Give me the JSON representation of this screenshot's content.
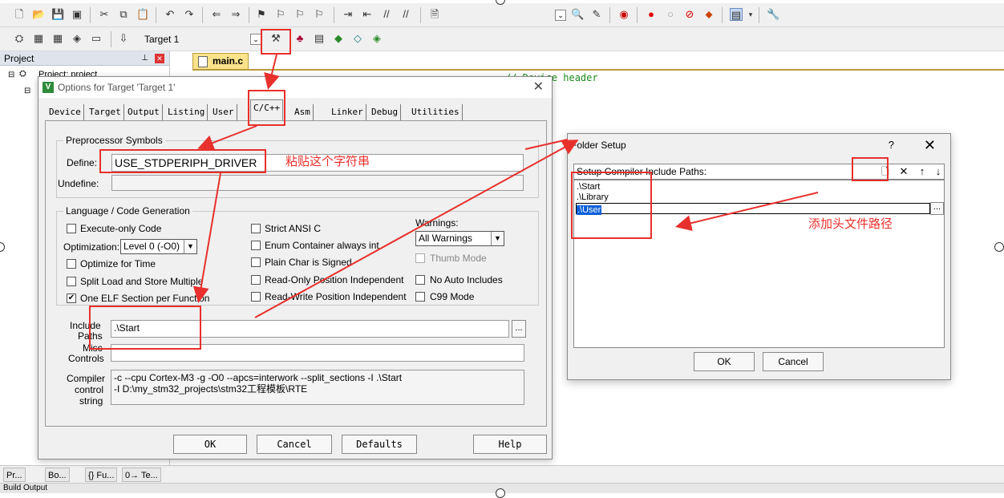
{
  "toolbar2": {
    "target_name": "Target 1"
  },
  "project_panel": {
    "title": "Project",
    "tree_root": "Project: project"
  },
  "bottom_tabs": [
    "Pr...",
    "Bo...",
    "{} Fu...",
    "0→ Te..."
  ],
  "status_text": "Build Output",
  "editor": {
    "tab_label": "main.c",
    "code_comment": "// Device header"
  },
  "options_dialog": {
    "title": "Options for Target 'Target 1'",
    "tabs": [
      "Device",
      "Target",
      "Output",
      "Listing",
      "User",
      "C/C++",
      "Asm",
      "Linker",
      "Debug",
      "Utilities"
    ],
    "preprocessor": {
      "group_title": "Preprocessor Symbols",
      "define_label": "Define:",
      "define_value": "USE_STDPERIPH_DRIVER",
      "undefine_label": "Undefine:"
    },
    "language": {
      "group_title": "Language / Code Generation",
      "execute_only": "Execute-only Code",
      "optimization_label": "Optimization:",
      "optimization_value": "Level 0 (-O0)",
      "optimize_for_time": "Optimize for Time",
      "split_load_store": "Split Load and Store Multiple",
      "one_elf": "One ELF Section per Function",
      "strict_ansi": "Strict ANSI C",
      "enum_container": "Enum Container always int",
      "plain_char": "Plain Char is Signed",
      "ro_position": "Read-Only Position Independent",
      "rw_position": "Read-Write Position Independent",
      "warnings_label": "Warnings:",
      "warnings_value": "All Warnings",
      "thumb_mode": "Thumb Mode",
      "no_auto_includes": "No Auto Includes",
      "c99_mode": "C99 Mode"
    },
    "include_paths_label_1": "Include",
    "include_paths_label_2": "Paths",
    "include_paths_value": ".\\Start",
    "misc_label_1": "Misc",
    "misc_label_2": "Controls",
    "compiler_label_1": "Compiler",
    "compiler_label_2": "control",
    "compiler_label_3": "string",
    "compiler_line1": "-c --cpu Cortex-M3 -g -O0 --apcs=interwork --split_sections -I .\\Start",
    "compiler_line2": "-I D:\\my_stm32_projects\\stm32工程模板\\RTE",
    "buttons": {
      "ok": "OK",
      "cancel": "Cancel",
      "defaults": "Defaults",
      "help": "Help"
    }
  },
  "folder_dialog": {
    "title": "Folder Setup",
    "help_mark": "?",
    "header": "Setup Compiler Include Paths:",
    "paths": [
      ".\\Start",
      ".\\Library",
      ".\\User"
    ],
    "browse_label": "...",
    "ok": "OK",
    "cancel": "Cancel"
  },
  "annotations": {
    "paste_string": "粘贴这个字符串",
    "add_header_path": "添加头文件路径"
  },
  "colors": {
    "annotation_red": "#e8302c",
    "selection_blue": "#0a5fd8",
    "editor_tab": "#fbe38b"
  }
}
